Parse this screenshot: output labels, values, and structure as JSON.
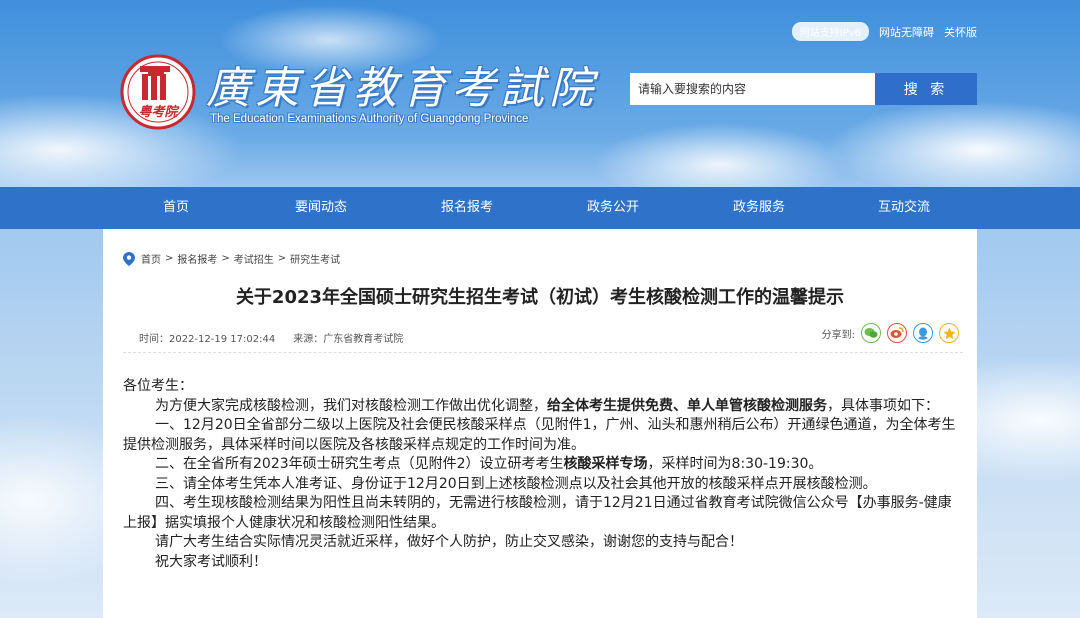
{
  "header": {
    "top_links": {
      "ipv6": "网站支持IPv6",
      "accessibility": "网站无障碍",
      "care_mode": "关怀版"
    },
    "logo_text": "粤考院",
    "title": "廣東省教育考試院",
    "subtitle": "The Education Examinations Authority of Guangdong Province",
    "search": {
      "placeholder": "请输入要搜索的内容",
      "button_label": "搜 索"
    }
  },
  "nav": {
    "items": [
      "首页",
      "要闻动态",
      "报名报考",
      "政务公开",
      "政务服务",
      "互动交流"
    ]
  },
  "breadcrumb": [
    "首页",
    "报名报考",
    "考试招生",
    "研究生考试"
  ],
  "article": {
    "title": "关于2023年全国硕士研究生招生考试（初试）考生核酸检测工作的温馨提示",
    "time": "时间：2022-12-19 17:02:44",
    "source": "来源：广东省教育考试院",
    "share_label": "分享到:",
    "share_icons": [
      "wechat-icon",
      "weibo-icon",
      "qq-icon",
      "qzone-icon"
    ],
    "greeting": "各位考生：",
    "p1_a": "为方便大家完成核酸检测，我们对核酸检测工作做出优化调整，",
    "p1_bold": "给全体考生提供免费、单人单管核酸检测服务",
    "p1_b": "，具体事项如下：",
    "p2": "一、12月20日全省部分二级以上医院及社会便民核酸采样点（见附件1，广州、汕头和惠州稍后公布）开通绿色通道，为全体考生提供检测服务，具体采样时间以医院及各核酸采样点规定的工作时间为准。",
    "p3_a": "二、在全省所有2023年硕士研究生考点（见附件2）设立研考考生",
    "p3_bold": "核酸采样专场",
    "p3_b": "，采样时间为8:30-19:30。",
    "p4": "三、请全体考生凭本人准考证、身份证于12月20日到上述核酸检测点以及社会其他开放的核酸采样点开展核酸检测。",
    "p5": "四、考生现核酸检测结果为阳性且尚未转阴的，无需进行核酸检测，请于12月21日通过省教育考试院微信公众号【办事服务-健康上报】据实填报个人健康状况和核酸检测阳性结果。",
    "p6": "请广大考生结合实际情况灵活就近采样，做好个人防护，防止交叉感染，谢谢您的支持与配合！",
    "p7": "祝大家考试顺利！"
  },
  "colors": {
    "nav_bg": "#2e73c9",
    "search_button": "#2f6fcb",
    "logo_red": "#c8282e"
  }
}
